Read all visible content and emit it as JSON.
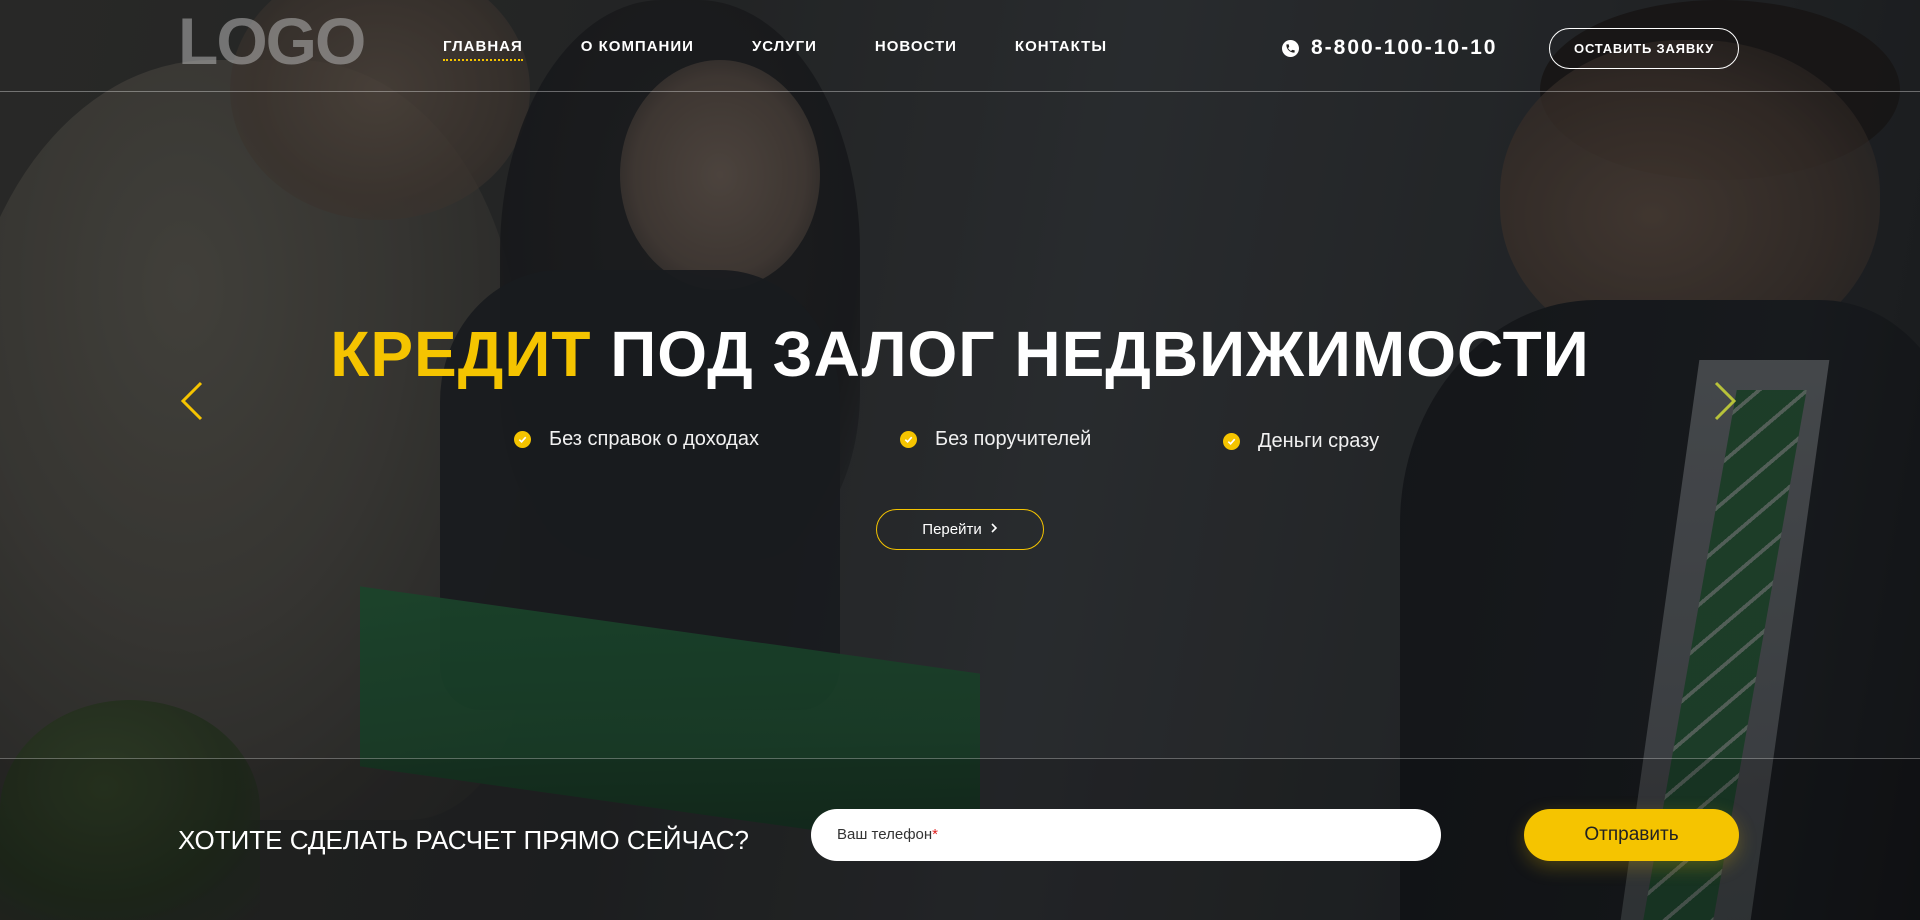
{
  "header": {
    "logo": "LOGO",
    "nav": [
      {
        "label": "ГЛАВНАЯ",
        "active": true
      },
      {
        "label": "О КОМПАНИИ",
        "active": false
      },
      {
        "label": "УСЛУГИ",
        "active": false
      },
      {
        "label": "НОВОСТИ",
        "active": false
      },
      {
        "label": "КОНТАКТЫ",
        "active": false
      }
    ],
    "phone": "8-800-100-10-10",
    "phone_icon": "phone-icon",
    "cta_label": "ОСТАВИТЬ ЗАЯВКУ"
  },
  "hero": {
    "headline_accent": "КРЕДИТ",
    "headline_rest": " ПОД ЗАЛОГ НЕДВИЖИМОСТИ",
    "features": [
      {
        "text": "Без справок о доходах",
        "icon": "check-icon"
      },
      {
        "text": "Без поручителей",
        "icon": "check-icon"
      },
      {
        "text": "Деньги сразу",
        "icon": "check-icon"
      }
    ],
    "go_label": "Перейти",
    "go_icon": "chevron-right-icon",
    "prev_icon": "chevron-left-icon",
    "next_icon": "chevron-right-icon"
  },
  "form": {
    "title": "ХОТИТЕ СДЕЛАТЬ РАСЧЕТ ПРЯМО СЕЙЧАС?",
    "phone_placeholder": "Ваш телефон",
    "required_mark": "*",
    "phone_value": "",
    "submit_label": "Отправить"
  },
  "colors": {
    "accent": "#f5c400",
    "text": "#ffffff",
    "required": "#e02020"
  }
}
